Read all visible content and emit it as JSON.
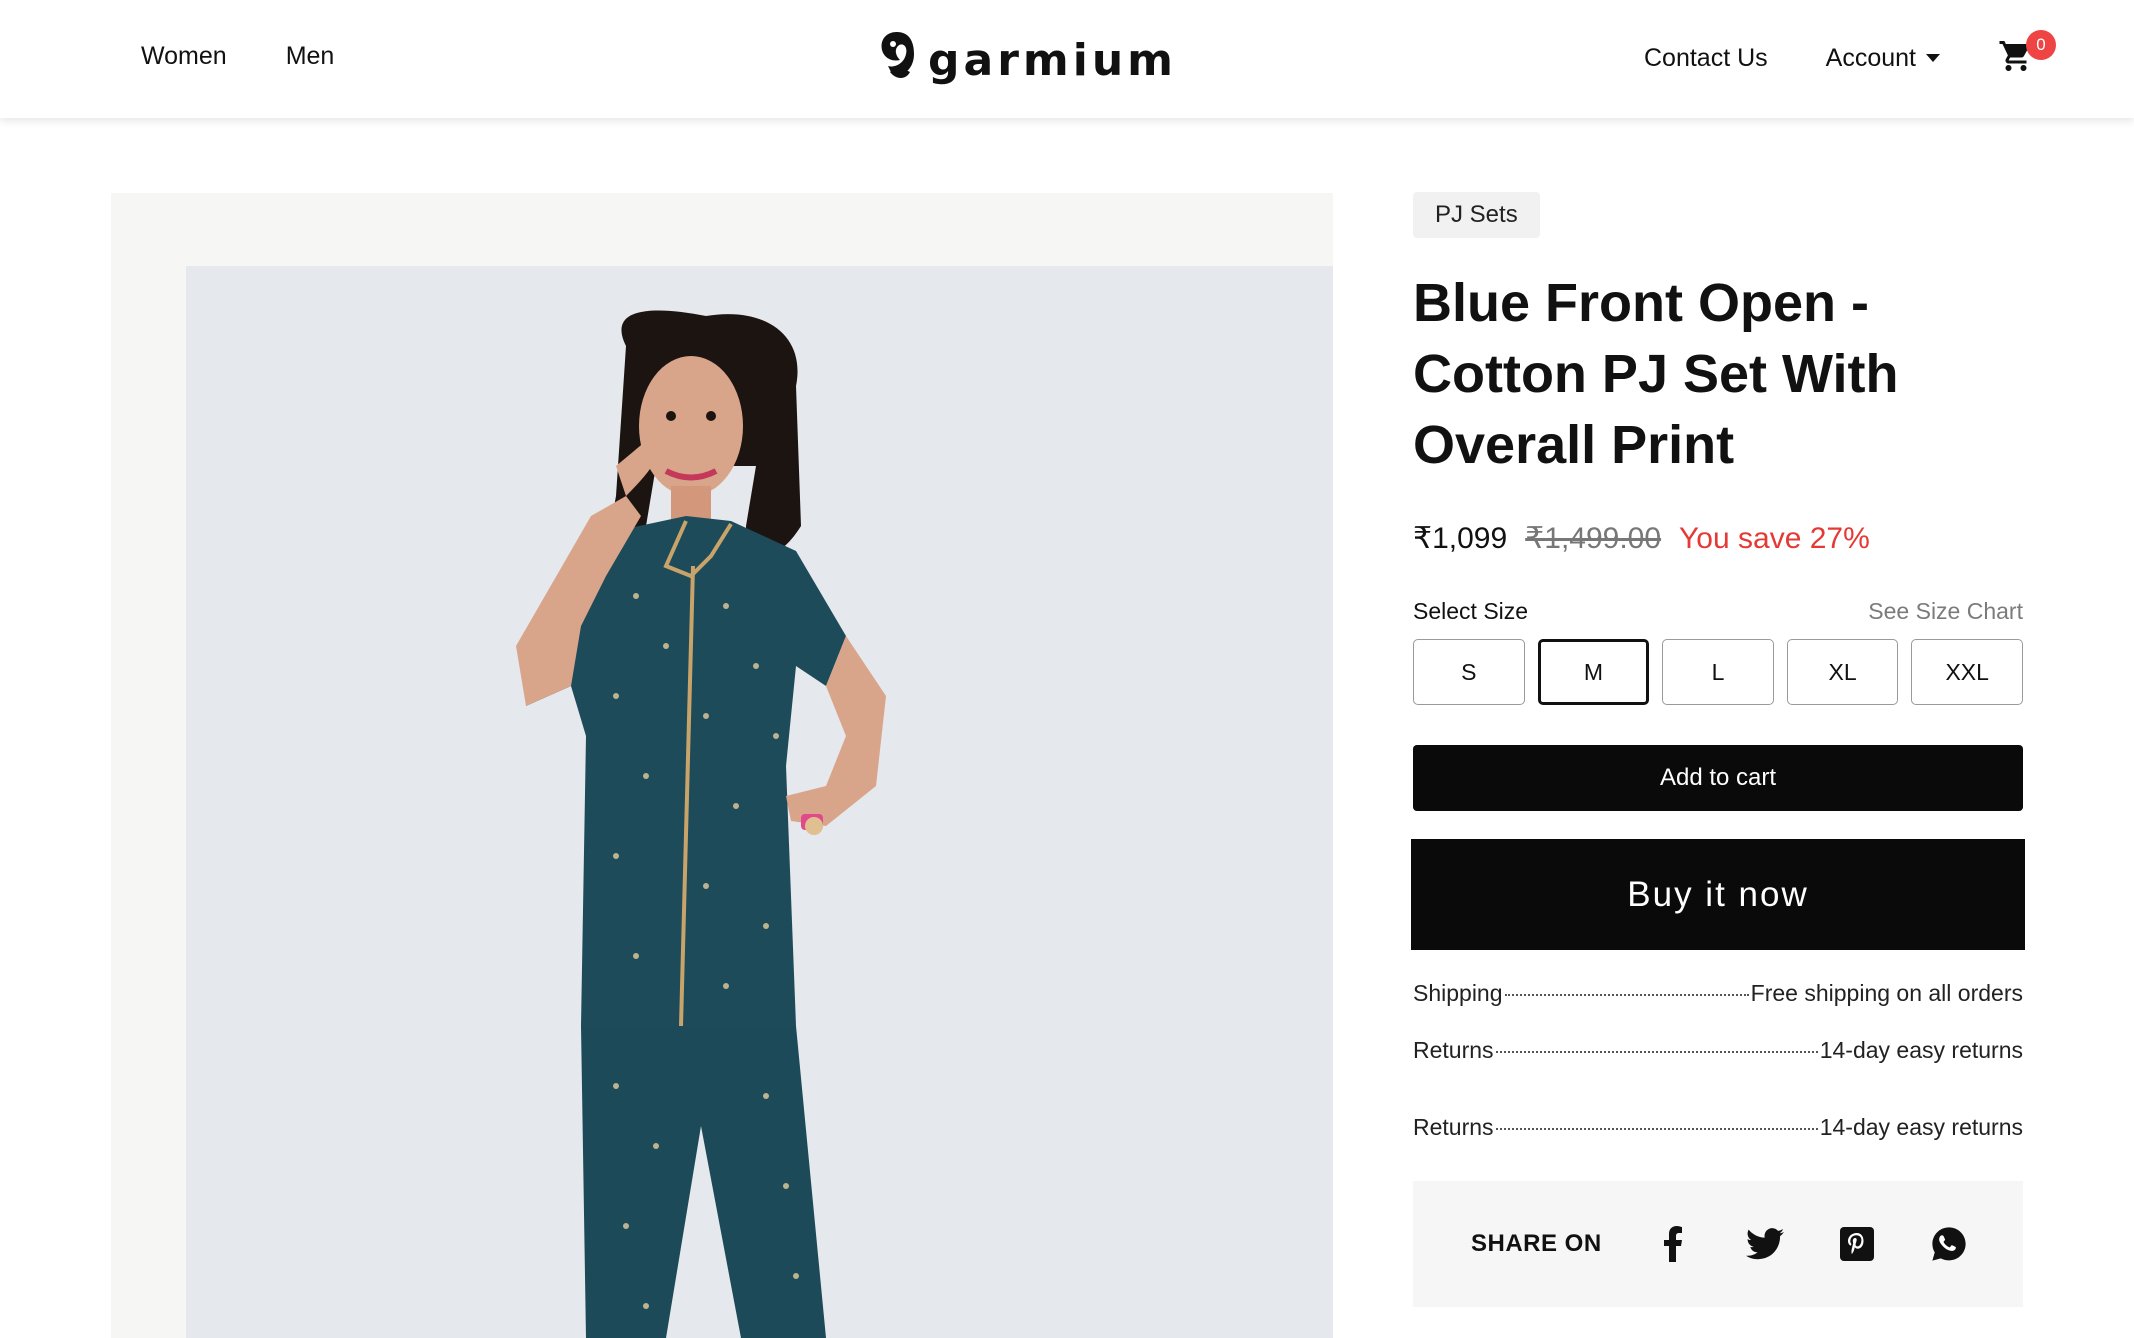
{
  "header": {
    "nav_left": [
      "Women",
      "Men"
    ],
    "logo_text": "garmium",
    "contact_label": "Contact Us",
    "account_label": "Account",
    "cart_count": "0",
    "badge_color": "#ef4444"
  },
  "product": {
    "category_tag": "PJ Sets",
    "title": "Blue Front Open - Cotton PJ Set With Overall Print",
    "price": "₹1,099",
    "compare_price": "₹1,499.00",
    "save_text": "You save 27%",
    "save_color": "#e53935",
    "select_size_label": "Select Size",
    "size_chart_link": "See Size Chart",
    "sizes": [
      "S",
      "M",
      "L",
      "XL",
      "XXL"
    ],
    "selected_size": "M",
    "add_to_cart_label": "Add to cart",
    "buy_now_label": "Buy it now",
    "image_alt_icon": "product-photo-model-pj-set"
  },
  "details": [
    {
      "label": "Shipping",
      "value": "Free shipping on all orders"
    },
    {
      "label": "Returns",
      "value": "14-day easy returns"
    },
    {
      "label": "Returns",
      "value": "14-day easy returns"
    }
  ],
  "share": {
    "label": "SHARE ON",
    "icons": [
      "facebook-icon",
      "twitter-icon",
      "pinterest-icon",
      "whatsapp-icon"
    ]
  }
}
